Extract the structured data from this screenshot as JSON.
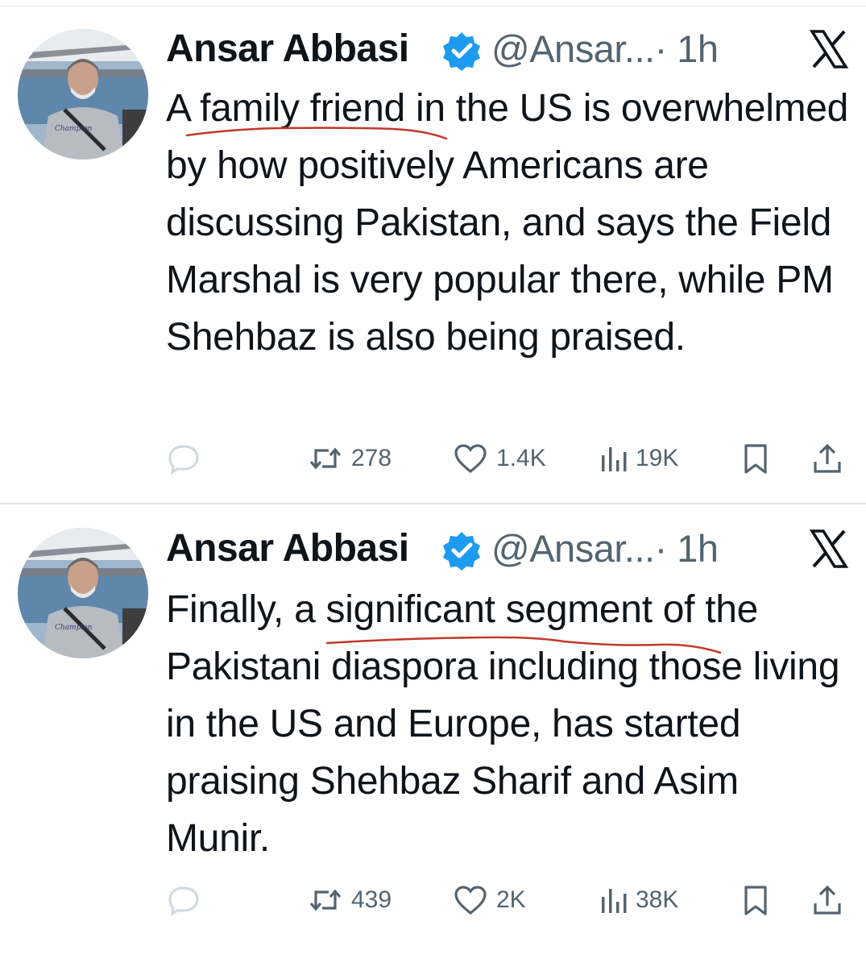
{
  "tweets": [
    {
      "author": {
        "name": "Ansar Abbasi",
        "handle": "@Ansar...",
        "time": "· 1h",
        "verified": true
      },
      "text": "A family friend in the US is overwhelmed by how positively Americans are discussing Pakistan, and says the Field Marshal is very popular there, while PM Shehbaz is also being praised.",
      "highlighted_phrase": "family friend",
      "stats": {
        "reposts": "278",
        "likes": "1.4K",
        "views": "19K"
      }
    },
    {
      "author": {
        "name": "Ansar Abbasi",
        "handle": "@Ansar...",
        "time": "· 1h",
        "verified": true
      },
      "text": "Finally, a significant segment of the Pakistani diaspora including those living in the US and Europe, has started praising Shehbaz Sharif and Asim Munir.",
      "highlighted_phrase": "significant segment",
      "stats": {
        "reposts": "439",
        "likes": "2K",
        "views": "38K"
      }
    }
  ],
  "icons": {
    "reply": "reply-bubble-icon",
    "repost": "repost-icon",
    "like": "heart-icon",
    "views": "views-bar-chart-icon",
    "bookmark": "bookmark-icon",
    "share": "share-upload-icon",
    "platform": "x-logo-icon",
    "verified": "verified-badge-icon"
  },
  "colors": {
    "text": "#0f1419",
    "secondary": "#536471",
    "verified_blue": "#1d9bf0",
    "annotation_red": "#c0392b",
    "divider": "#e3e3e3"
  }
}
